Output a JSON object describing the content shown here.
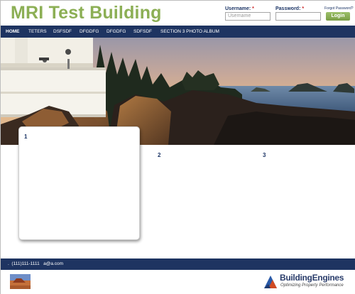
{
  "site": {
    "title": "MRI Test Building"
  },
  "login": {
    "username_label": "Username:",
    "username_required": "*",
    "username_placeholder": "Username",
    "password_label": "Password:",
    "password_required": "*",
    "password_placeholder": "",
    "forgot_label": "Forgot Password?",
    "login_button": "Login"
  },
  "nav": {
    "items": [
      {
        "label": "HOME"
      },
      {
        "label": "TETERS"
      },
      {
        "label": "DSFSDF"
      },
      {
        "label": "DFGDFG"
      },
      {
        "label": "DFGDFG"
      },
      {
        "label": "SDFSDF"
      },
      {
        "label": "SECTION 3 PHOTO ALBUM"
      }
    ]
  },
  "content": {
    "columns": [
      {
        "number": "1"
      },
      {
        "number": "2"
      },
      {
        "number": "3"
      }
    ]
  },
  "footer": {
    "contact": ".  (111)111-1111   a@a.com"
  },
  "branding": {
    "name": "BuildingEngines",
    "tagline": "Optimizing Property Performance"
  },
  "colors": {
    "title_green": "#8caf55",
    "navy": "#1e3461",
    "login_green": "#7a9e45"
  },
  "icons": {
    "logo": "building-engines-logo-icon",
    "thumbnail": "desert-landscape-thumbnail"
  }
}
